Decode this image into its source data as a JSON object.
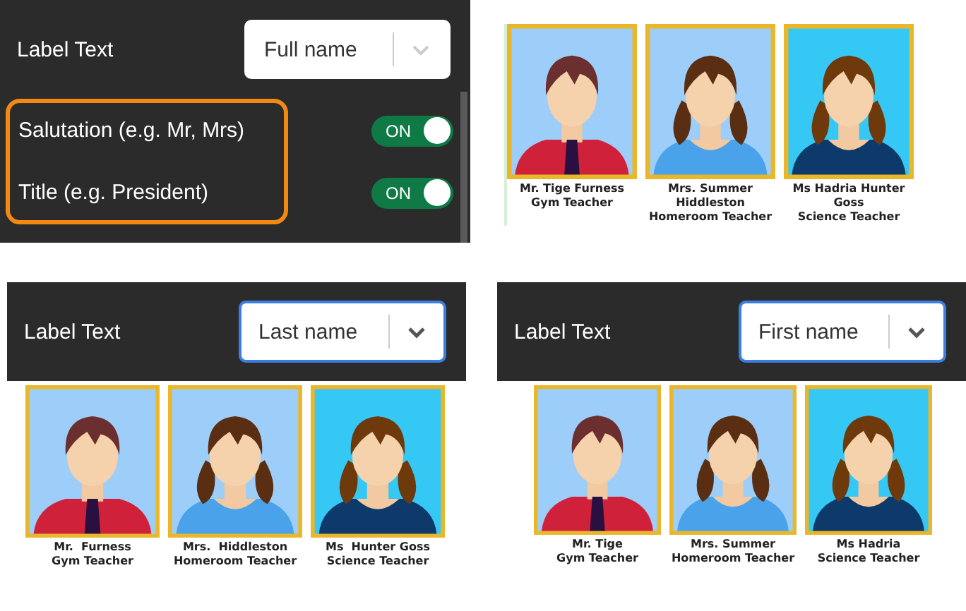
{
  "examples": [
    {
      "kind": "side",
      "label": "Label Text",
      "dropdown": {
        "value": "Full name",
        "focused": false
      },
      "highlighted": true,
      "toggles": [
        {
          "label": "Salutation (e.g. Mr, Mrs)",
          "on": true,
          "state_text": "ON"
        },
        {
          "label": "Title (e.g. President)",
          "on": true,
          "state_text": "ON"
        }
      ],
      "cards": [
        {
          "kind": "tie",
          "name": "Mr. Tige Furness",
          "role": "Gym Teacher"
        },
        {
          "kind": "pigtails",
          "name": "Mrs. Summer Hiddleston",
          "role": "Homeroom Teacher"
        },
        {
          "kind": "dark",
          "name": "Ms Hadria Hunter Goss",
          "role": "Science Teacher"
        }
      ]
    },
    {
      "kind": "stacked",
      "label": "Label Text",
      "dropdown": {
        "value": "Last name",
        "focused": true
      },
      "cards": [
        {
          "kind": "tie",
          "name": "Mr.  Furness",
          "role": "Gym Teacher"
        },
        {
          "kind": "pigtails",
          "name": "Mrs.  Hiddleston",
          "role": "Homeroom Teacher"
        },
        {
          "kind": "dark",
          "name": "Ms  Hunter Goss",
          "role": "Science Teacher"
        }
      ]
    },
    {
      "kind": "stacked",
      "label": "Label Text",
      "dropdown": {
        "value": "First name",
        "focused": true
      },
      "cards": [
        {
          "kind": "tie",
          "name": "Mr. Tige",
          "role": "Gym Teacher"
        },
        {
          "kind": "pigtails",
          "name": "Mrs. Summer",
          "role": "Homeroom Teacher"
        },
        {
          "kind": "dark",
          "name": "Ms Hadria",
          "role": "Science Teacher"
        }
      ]
    }
  ]
}
